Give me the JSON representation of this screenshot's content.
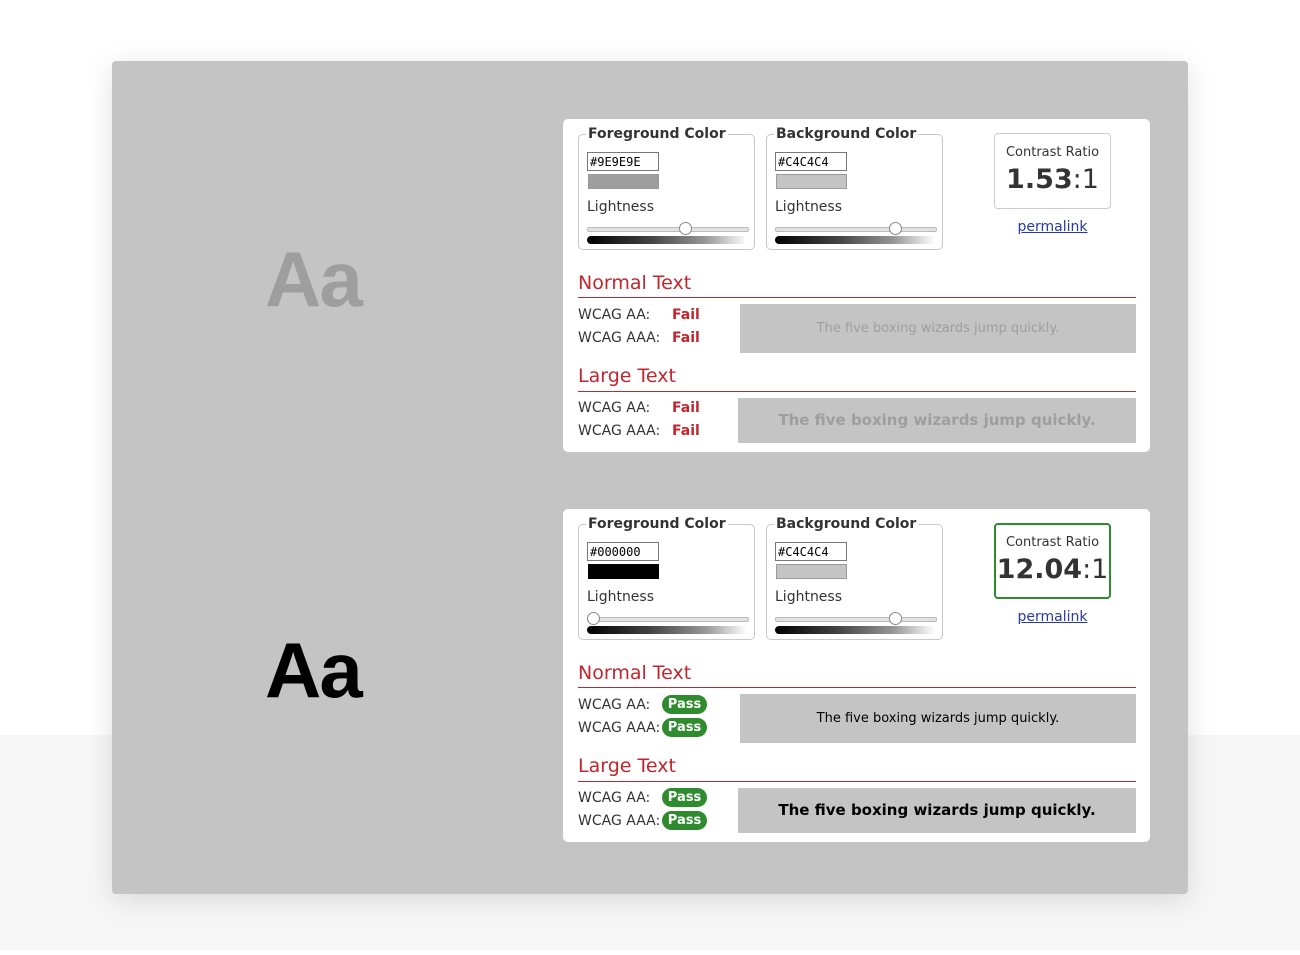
{
  "panels": [
    {
      "sample_text": "Aa",
      "foreground": {
        "legend": "Foreground Color",
        "hex": "#9E9E9E",
        "lightness_label": "Lightness",
        "lightness": 0.62
      },
      "background": {
        "legend": "Background Color",
        "hex": "#C4C4C4",
        "lightness_label": "Lightness",
        "lightness": 0.77
      },
      "contrast": {
        "label": "Contrast Ratio",
        "ratio": "1.53",
        "suffix": ":1",
        "status": "fail"
      },
      "permalink": "permalink",
      "normal": {
        "title": "Normal Text",
        "aa_label": "WCAG AA:",
        "aa_result": "Fail",
        "aaa_label": "WCAG AAA:",
        "aaa_result": "Fail",
        "preview": "The five boxing wizards jump quickly."
      },
      "large": {
        "title": "Large Text",
        "aa_label": "WCAG AA:",
        "aa_result": "Fail",
        "aaa_label": "WCAG AAA:",
        "aaa_result": "Fail",
        "preview": "The five boxing wizards jump quickly."
      }
    },
    {
      "sample_text": "Aa",
      "foreground": {
        "legend": "Foreground Color",
        "hex": "#000000",
        "lightness_label": "Lightness",
        "lightness": 0.0
      },
      "background": {
        "legend": "Background Color",
        "hex": "#C4C4C4",
        "lightness_label": "Lightness",
        "lightness": 0.77
      },
      "contrast": {
        "label": "Contrast Ratio",
        "ratio": "12.04",
        "suffix": ":1",
        "status": "pass"
      },
      "permalink": "permalink",
      "normal": {
        "title": "Normal Text",
        "aa_label": "WCAG AA:",
        "aa_result": "Pass",
        "aaa_label": "WCAG AAA:",
        "aaa_result": "Pass",
        "preview": "The five boxing wizards jump quickly."
      },
      "large": {
        "title": "Large Text",
        "aa_label": "WCAG AA:",
        "aa_result": "Pass",
        "aaa_label": "WCAG AAA:",
        "aaa_result": "Pass",
        "preview": "The five boxing wizards jump quickly."
      }
    }
  ],
  "colors": {
    "panel_bg": "#C4C4C4",
    "fail_red": "#C0262D",
    "pass_green": "#2E8B2E",
    "link_blue": "#2A38A0"
  }
}
